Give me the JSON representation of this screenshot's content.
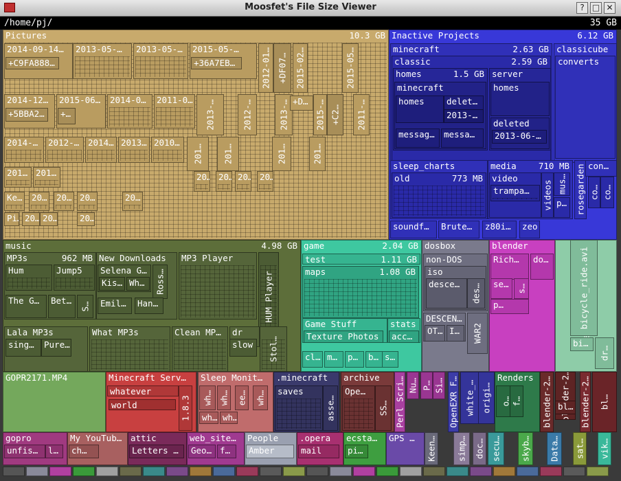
{
  "window": {
    "title": "Moosfet's File Size Viewer"
  },
  "path": {
    "current": "/home/pj/",
    "total": "35 GB"
  },
  "colors": {
    "pictures": "#c8aa6c",
    "inactive": "#3838d8",
    "music": "#5d6e3a",
    "game": "#3ec8a0",
    "dosbox": "#7a7a8c",
    "blender": "#c840c0",
    "keepable": "#8ecca8"
  },
  "blocks": [
    {
      "id": "pictures",
      "label": "Pictures",
      "size": "10.3 GB",
      "color": "#c8aa6c",
      "tex": 1
    },
    {
      "id": "p1",
      "label": "2014-09-14…",
      "color": "#b99c60"
    },
    {
      "id": "p1b",
      "label": "+C9FA888…",
      "color": "#a88e58"
    },
    {
      "id": "p2",
      "label": "2013-05-…",
      "color": "#b99c60",
      "tex": 1
    },
    {
      "id": "p3",
      "label": "2013-05-…",
      "color": "#b99c60",
      "tex": 1
    },
    {
      "id": "p4",
      "label": "2015-05-…",
      "color": "#b99c60"
    },
    {
      "id": "p4b",
      "label": "+36A7EB…",
      "color": "#a88e58"
    },
    {
      "id": "p5",
      "label": "2012-01…",
      "color": "#b99c60",
      "v": 1
    },
    {
      "id": "p5b",
      "label": "+DF07…",
      "color": "#a88e58",
      "v": 1
    },
    {
      "id": "p6",
      "label": "2015-02…",
      "color": "#b99c60",
      "v": 1
    },
    {
      "id": "p7",
      "label": "2015-05…",
      "color": "#b99c60",
      "v": 1
    },
    {
      "id": "p8",
      "label": "2014-12…",
      "color": "#b99c60"
    },
    {
      "id": "p8b",
      "label": "+5BBA2…",
      "color": "#a88e58"
    },
    {
      "id": "p9",
      "label": "2015-06…",
      "color": "#b99c60"
    },
    {
      "id": "p9b",
      "label": "+…",
      "color": "#a88e58"
    },
    {
      "id": "p10",
      "label": "2014-0…",
      "color": "#b99c60",
      "tex": 1
    },
    {
      "id": "p11",
      "label": "2011-0…",
      "color": "#b99c60",
      "tex": 1
    },
    {
      "id": "p12",
      "label": "2013-…",
      "color": "#b99c60",
      "v": 1
    },
    {
      "id": "p13",
      "label": "2012-…",
      "color": "#b99c60",
      "v": 1
    },
    {
      "id": "p14",
      "label": "2013-…",
      "color": "#b99c60",
      "v": 1
    },
    {
      "id": "p15",
      "label": "+D…",
      "color": "#b99c60"
    },
    {
      "id": "p16",
      "label": "2015-…",
      "color": "#b99c60",
      "v": 1
    },
    {
      "id": "p16b",
      "label": "+C2…",
      "color": "#a88e58",
      "v": 1
    },
    {
      "id": "p17",
      "label": "2011-…",
      "color": "#b99c60",
      "v": 1
    },
    {
      "id": "p18",
      "label": "2014-…",
      "color": "#b99c60",
      "tex": 1
    },
    {
      "id": "p19",
      "label": "2012-…",
      "color": "#b99c60",
      "tex": 1
    },
    {
      "id": "p20",
      "label": "2014…",
      "color": "#b99c60",
      "tex": 1
    },
    {
      "id": "p21",
      "label": "2013…",
      "color": "#b99c60",
      "tex": 1
    },
    {
      "id": "p22",
      "label": "2010…",
      "color": "#b99c60",
      "tex": 1
    },
    {
      "id": "p23",
      "label": "201…",
      "color": "#b99c60",
      "v": 1
    },
    {
      "id": "p24",
      "label": "201…",
      "color": "#b99c60",
      "v": 1
    },
    {
      "id": "p25",
      "label": "201…",
      "color": "#b99c60",
      "v": 1
    },
    {
      "id": "p26",
      "label": "201…",
      "color": "#b99c60",
      "v": 1
    },
    {
      "id": "p27",
      "label": "201…",
      "color": "#b99c60",
      "tex": 1
    },
    {
      "id": "p28",
      "label": "201…",
      "color": "#b99c60",
      "tex": 1
    },
    {
      "id": "p29",
      "label": "20…",
      "color": "#b99c60",
      "tex": 1
    },
    {
      "id": "p30",
      "label": "20…",
      "color": "#b99c60",
      "tex": 1
    },
    {
      "id": "p31",
      "label": "20…",
      "color": "#b99c60",
      "tex": 1
    },
    {
      "id": "p32",
      "label": "20…",
      "color": "#b99c60",
      "tex": 1
    },
    {
      "id": "p33",
      "label": "Ke…",
      "color": "#b99c60",
      "tex": 1
    },
    {
      "id": "p34",
      "label": "20…",
      "color": "#b99c60",
      "tex": 1
    },
    {
      "id": "p35",
      "label": "20…",
      "color": "#b99c60",
      "tex": 1
    },
    {
      "id": "p36",
      "label": "20…",
      "color": "#b99c60",
      "tex": 1
    },
    {
      "id": "p37",
      "label": "20…",
      "color": "#b99c60",
      "tex": 1
    },
    {
      "id": "p38",
      "label": "Pi…",
      "color": "#b99c60",
      "tex": 1
    },
    {
      "id": "p39",
      "label": "20…",
      "color": "#b99c60",
      "tex": 1
    },
    {
      "id": "p40",
      "label": "20…",
      "color": "#b99c60",
      "tex": 1
    },
    {
      "id": "p41",
      "label": "20…",
      "color": "#b99c60",
      "tex": 1
    },
    {
      "id": "inactive",
      "label": "Inactive Projects",
      "size": "6.12 GB",
      "color": "#3838d8"
    },
    {
      "id": "minecraft",
      "label": "minecraft",
      "size": "2.63 GB",
      "color": "#3030b8"
    },
    {
      "id": "classic",
      "label": "classic",
      "size": "2.59 GB",
      "color": "#2a2aa8"
    },
    {
      "id": "homes",
      "label": "homes",
      "size": "1.5 GB",
      "color": "#262698"
    },
    {
      "id": "mc2",
      "label": "minecraft",
      "color": "#222288"
    },
    {
      "id": "mchomes",
      "label": "homes",
      "color": "#1e1e7c"
    },
    {
      "id": "mcdel",
      "label": "delet…",
      "color": "#1e1e7c"
    },
    {
      "id": "mcdel2",
      "label": "2013-…",
      "color": "#1a1a70"
    },
    {
      "id": "messag1",
      "label": "messag…",
      "color": "#1e1e7c"
    },
    {
      "id": "messag2",
      "label": "messa…",
      "color": "#1e1e7c"
    },
    {
      "id": "server",
      "label": "server",
      "color": "#262698"
    },
    {
      "id": "shomes",
      "label": "homes",
      "color": "#222288"
    },
    {
      "id": "sdeleted",
      "label": "deleted",
      "color": "#222288"
    },
    {
      "id": "sdel2",
      "label": "2013-06-…",
      "color": "#1e1e7c"
    },
    {
      "id": "classicube",
      "label": "classicube",
      "color": "#3434c4"
    },
    {
      "id": "converts",
      "label": "converts",
      "color": "#3030b8"
    },
    {
      "id": "sleep",
      "label": "sleep_charts",
      "color": "#3030b8"
    },
    {
      "id": "old",
      "label": "old",
      "size": "773 MB",
      "color": "#2a2aa8",
      "tex": 1
    },
    {
      "id": "media",
      "label": "media",
      "size": "710 MB",
      "color": "#3030b8"
    },
    {
      "id": "video",
      "label": "video",
      "color": "#2a2aa8"
    },
    {
      "id": "trampa",
      "label": "trampa…",
      "color": "#262698",
      "tex": 1
    },
    {
      "id": "videos",
      "label": "videos",
      "color": "#2a2aa8",
      "v": 1
    },
    {
      "id": "mus",
      "label": "mus…",
      "color": "#2a2aa8",
      "v": 1
    },
    {
      "id": "pmed",
      "label": "p…",
      "color": "#2a2aa8"
    },
    {
      "id": "rosegarden",
      "label": "rosegarden",
      "color": "#3030b8",
      "v": 1
    },
    {
      "id": "con",
      "label": "con…",
      "color": "#3030b8"
    },
    {
      "id": "co1",
      "label": "co…",
      "color": "#2a2aa8",
      "v": 1
    },
    {
      "id": "co2",
      "label": "co…",
      "color": "#2a2aa8",
      "v": 1
    },
    {
      "id": "soundf",
      "label": "soundf…",
      "color": "#3030b8"
    },
    {
      "id": "brute",
      "label": "Brute…",
      "color": "#3030b8"
    },
    {
      "id": "z80",
      "label": "z80i…",
      "color": "#3030b8"
    },
    {
      "id": "zeo",
      "label": "zeo",
      "color": "#3030b8"
    },
    {
      "id": "music",
      "label": "music",
      "size": "4.98 GB",
      "color": "#5d6e3a"
    },
    {
      "id": "mp3s",
      "label": "MP3s",
      "size": "962 MB",
      "color": "#55653a"
    },
    {
      "id": "hum",
      "label": "Hum",
      "color": "#4c5c34",
      "tex": 1
    },
    {
      "id": "jump5",
      "label": "Jump5",
      "color": "#4c5c34",
      "tex": 1
    },
    {
      "id": "theg",
      "label": "The G…",
      "color": "#4c5c34"
    },
    {
      "id": "bet",
      "label": "Bet…",
      "color": "#4c5c34"
    },
    {
      "id": "s1",
      "label": "S…",
      "color": "#4c5c34",
      "v": 1
    },
    {
      "id": "newdl",
      "label": "New Downloads",
      "color": "#55653a"
    },
    {
      "id": "selena",
      "label": "Selena G…",
      "color": "#4c5c34"
    },
    {
      "id": "kis",
      "label": "Kis…",
      "color": "#46552f"
    },
    {
      "id": "wh",
      "label": "Wh…",
      "color": "#46552f"
    },
    {
      "id": "ross",
      "label": "Ross…",
      "color": "#4c5c34",
      "v": 1
    },
    {
      "id": "emil",
      "label": "Emil…",
      "color": "#4c5c34"
    },
    {
      "id": "han",
      "label": "Han…",
      "color": "#4c5c34"
    },
    {
      "id": "mp3player",
      "label": "MP3 Player",
      "color": "#55653a",
      "tex": 1
    },
    {
      "id": "humplayer",
      "label": "HUM Player",
      "color": "#4c5c34",
      "v": 1,
      "tex": 1
    },
    {
      "id": "lala",
      "label": "Lala MP3s",
      "color": "#55653a"
    },
    {
      "id": "sing",
      "label": "sing…",
      "color": "#4c5c34"
    },
    {
      "id": "pure",
      "label": "Pure…",
      "color": "#4c5c34"
    },
    {
      "id": "whatmp3",
      "label": "What MP3s",
      "color": "#55653a",
      "tex": 1
    },
    {
      "id": "cleanmp",
      "label": "Clean MP…",
      "color": "#55653a",
      "tex": 1
    },
    {
      "id": "dr",
      "label": "dr",
      "color": "#55653a"
    },
    {
      "id": "slow",
      "label": "slow",
      "color": "#4c5c34"
    },
    {
      "id": "stol",
      "label": "Stol…",
      "color": "#55653a",
      "v": 1,
      "tex": 1
    },
    {
      "id": "game",
      "label": "game",
      "size": "2.04 GB",
      "color": "#3ec8a0"
    },
    {
      "id": "test",
      "label": "test",
      "size": "1.11 GB",
      "color": "#36b490"
    },
    {
      "id": "maps",
      "label": "maps",
      "size": "1.08 GB",
      "color": "#30a482",
      "tex": 1
    },
    {
      "id": "gamestuff",
      "label": "Game Stuff",
      "color": "#36b490"
    },
    {
      "id": "texture",
      "label": "Texture Photos",
      "color": "#30a482"
    },
    {
      "id": "stats",
      "label": "stats",
      "color": "#36b490"
    },
    {
      "id": "acc",
      "label": "acc…",
      "color": "#30a482"
    },
    {
      "id": "cl",
      "label": "cl…",
      "color": "#36b490"
    },
    {
      "id": "gm",
      "label": "m…",
      "color": "#36b490"
    },
    {
      "id": "gp",
      "label": "p…",
      "color": "#36b490"
    },
    {
      "id": "gb",
      "label": "b…",
      "color": "#36b490"
    },
    {
      "id": "gs",
      "label": "s…",
      "color": "#36b490"
    },
    {
      "id": "dosbox",
      "label": "dosbox",
      "color": "#7a7a8c"
    },
    {
      "id": "nondos",
      "label": "non-DOS",
      "color": "#6e6e80"
    },
    {
      "id": "iso",
      "label": "iso",
      "color": "#656576"
    },
    {
      "id": "desce",
      "label": "desce…",
      "color": "#5b5b6c"
    },
    {
      "id": "des",
      "label": "des…",
      "color": "#5b5b6c",
      "v": 1
    },
    {
      "id": "descen",
      "label": "DESCEN…",
      "color": "#6e6e80"
    },
    {
      "id": "ot",
      "label": "OT…",
      "color": "#656576"
    },
    {
      "id": "di",
      "label": "I…",
      "color": "#656576"
    },
    {
      "id": "war2",
      "label": "WAR2",
      "color": "#6e6e80",
      "v": 1
    },
    {
      "id": "blender",
      "label": "blender",
      "color": "#c840c0"
    },
    {
      "id": "rich",
      "label": "Rich…",
      "color": "#b438ac"
    },
    {
      "id": "do",
      "label": "do…",
      "color": "#b438ac"
    },
    {
      "id": "se",
      "label": "se…",
      "color": "#b438ac"
    },
    {
      "id": "bs",
      "label": "s…",
      "color": "#b438ac",
      "v": 1
    },
    {
      "id": "bp",
      "label": "p…",
      "color": "#b438ac",
      "tex": 1
    },
    {
      "id": "keepable",
      "label": "Keepable Videos",
      "color": "#8ecca8",
      "v": 1
    },
    {
      "id": "bicycle",
      "label": "bicycle_ride.avi",
      "color": "#80bc9a",
      "v": 1
    },
    {
      "id": "bi",
      "label": "bi…",
      "color": "#80bc9a"
    },
    {
      "id": "drk",
      "label": "dr…",
      "color": "#80bc9a",
      "v": 1
    },
    {
      "id": "gopr",
      "label": "GOPR2171.MP4",
      "color": "#74a85c"
    },
    {
      "id": "mcserv",
      "label": "Minecraft Serv…",
      "color": "#c84040"
    },
    {
      "id": "whatever",
      "label": "whatever",
      "color": "#b03838"
    },
    {
      "id": "world",
      "label": "world",
      "color": "#a03030",
      "tex": 1
    },
    {
      "id": "v183",
      "label": "1.8.3",
      "color": "#b03838",
      "v": 1
    },
    {
      "id": "sleepmon",
      "label": "Sleep Monit…",
      "color": "#c06c6c"
    },
    {
      "id": "wh1",
      "label": "wh…",
      "color": "#a85a5a",
      "v": 1
    },
    {
      "id": "wh2",
      "label": "wh…",
      "color": "#a85a5a",
      "v": 1
    },
    {
      "id": "ee",
      "label": "ee…",
      "color": "#a85a5a",
      "v": 1
    },
    {
      "id": "wh3",
      "label": "wh…",
      "color": "#a85a5a",
      "v": 1
    },
    {
      "id": "wh4",
      "label": "wh…",
      "color": "#a85a5a"
    },
    {
      "id": "wh5",
      "label": "wh…",
      "color": "#a85a5a"
    },
    {
      "id": "dotmc",
      "label": ".minecraft",
      "color": "#3a3a6c"
    },
    {
      "id": "saves",
      "label": "saves",
      "color": "#33335e",
      "tex": 1
    },
    {
      "id": "asse",
      "label": "asse…",
      "color": "#33335e",
      "v": 1
    },
    {
      "id": "archive",
      "label": "archive",
      "color": "#7a3a3a"
    },
    {
      "id": "ope",
      "label": "Ope…",
      "color": "#6a3232",
      "tex": 1
    },
    {
      "id": "ss",
      "label": "SS…",
      "color": "#6a3232",
      "v": 1
    },
    {
      "id": "perl",
      "label": "Perl Scri…",
      "color": "#a840a0",
      "v": 1
    },
    {
      "id": "nu",
      "label": "Nu…",
      "color": "#9a3692",
      "v": 1
    },
    {
      "id": "ap",
      "label": "P…",
      "color": "#9a3692",
      "v": 1
    },
    {
      "id": "si",
      "label": "Si…",
      "color": "#9a3692",
      "v": 1
    },
    {
      "id": "openexr",
      "label": "OpenEXR F…",
      "color": "#3c3ca8",
      "v": 1
    },
    {
      "id": "white",
      "label": "white_…",
      "color": "#34349a",
      "v": 1
    },
    {
      "id": "origi",
      "label": "origi…",
      "color": "#34349a",
      "v": 1
    },
    {
      "id": "renders",
      "label": "Renders",
      "color": "#2e7a4a"
    },
    {
      "id": "ro",
      "label": "o…",
      "color": "#286a40",
      "v": 1
    },
    {
      "id": "rf",
      "label": "f…",
      "color": "#286a40",
      "v": 1
    },
    {
      "id": "bl2a",
      "label": "blender-2…",
      "color": "#6a2a2a",
      "v": 1
    },
    {
      "id": "bl2b",
      "label": "blender-2…",
      "color": "#5e2424",
      "v": 1
    },
    {
      "id": "bl2c",
      "label": "bl…",
      "color": "#5e2424"
    },
    {
      "id": "bl2d",
      "label": "blender-2…",
      "color": "#7a2a30",
      "v": 1
    },
    {
      "id": "bl2e",
      "label": "bl…",
      "color": "#6a2428",
      "v": 1
    },
    {
      "id": "gopro",
      "label": "gopro",
      "color": "#a03a80"
    },
    {
      "id": "unfis",
      "label": "unfis…",
      "color": "#8e3270"
    },
    {
      "id": "gl",
      "label": "l…",
      "color": "#8e3270"
    },
    {
      "id": "youtube",
      "label": "My YouTub…",
      "color": "#a86060"
    },
    {
      "id": "ch",
      "label": "ch…",
      "color": "#945252"
    },
    {
      "id": "attic",
      "label": "attic",
      "color": "#7a2a5a"
    },
    {
      "id": "letters",
      "label": "Letters …",
      "color": "#6a244e"
    },
    {
      "id": "website",
      "label": "web_site…",
      "color": "#a03a90"
    },
    {
      "id": "geo",
      "label": "Geo…",
      "color": "#8e3280"
    },
    {
      "id": "wf",
      "label": "f…",
      "color": "#8e3280"
    },
    {
      "id": "people",
      "label": "People",
      "color": "#9aa0b0"
    },
    {
      "id": "amber",
      "label": "Amber",
      "color": "#b6bcc8"
    },
    {
      "id": "opera",
      "label": ".opera",
      "color": "#a83070"
    },
    {
      "id": "mail",
      "label": "mail",
      "color": "#962a62"
    },
    {
      "id": "ecsta",
      "label": "ecsta…",
      "color": "#3e9e40"
    },
    {
      "id": "pi",
      "label": "pi…",
      "color": "#368a38"
    },
    {
      "id": "gps",
      "label": "GPS …",
      "color": "#6a4aa8"
    },
    {
      "id": "keen",
      "label": "Keen…",
      "color": "#6a6a7a",
      "v": 1
    },
    {
      "id": "simp",
      "label": "simp…",
      "color": "#8a7a98",
      "v": 1
    },
    {
      "id": "doc",
      "label": "doc…",
      "color": "#7a6a88",
      "v": 1
    },
    {
      "id": "secu",
      "label": "secu…",
      "color": "#3a9a9a",
      "v": 1
    },
    {
      "id": "skyb",
      "label": "skyb…",
      "color": "#4aa84a",
      "v": 1
    },
    {
      "id": "data",
      "label": "Data…",
      "color": "#3a7aa8",
      "v": 1
    },
    {
      "id": "sat",
      "label": "sat…",
      "color": "#8a9a3a",
      "v": 1
    },
    {
      "id": "vik",
      "label": "vik…",
      "color": "#3ab89a",
      "v": 1
    }
  ]
}
